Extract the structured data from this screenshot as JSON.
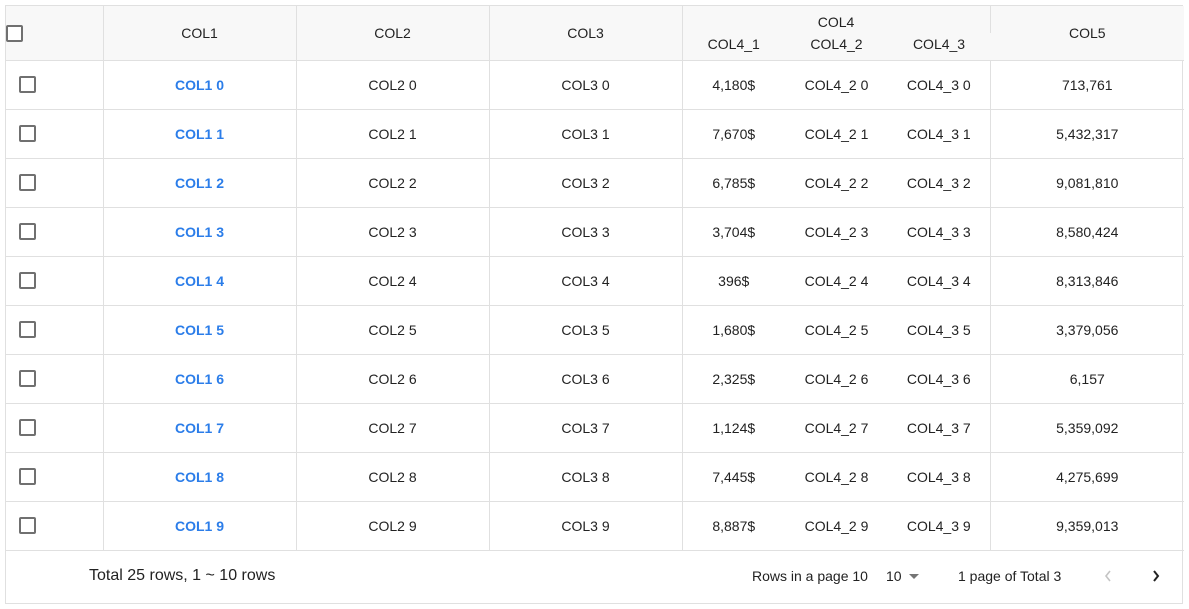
{
  "header": {
    "select_all_label": "",
    "col1": "COL1",
    "col2": "COL2",
    "col3": "COL3",
    "col4": "COL4",
    "col4_1": "COL4_1",
    "col4_2": "COL4_2",
    "col4_3": "COL4_3",
    "col5": "COL5"
  },
  "rows": [
    {
      "checked": false,
      "col1": "COL1 0",
      "col2": "COL2 0",
      "col3": "COL3 0",
      "col4_1": "4,180$",
      "col4_2": "COL4_2 0",
      "col4_3": "COL4_3 0",
      "col5": "713,761"
    },
    {
      "checked": false,
      "col1": "COL1 1",
      "col2": "COL2 1",
      "col3": "COL3 1",
      "col4_1": "7,670$",
      "col4_2": "COL4_2 1",
      "col4_3": "COL4_3 1",
      "col5": "5,432,317"
    },
    {
      "checked": false,
      "col1": "COL1 2",
      "col2": "COL2 2",
      "col3": "COL3 2",
      "col4_1": "6,785$",
      "col4_2": "COL4_2 2",
      "col4_3": "COL4_3 2",
      "col5": "9,081,810"
    },
    {
      "checked": false,
      "col1": "COL1 3",
      "col2": "COL2 3",
      "col3": "COL3 3",
      "col4_1": "3,704$",
      "col4_2": "COL4_2 3",
      "col4_3": "COL4_3 3",
      "col5": "8,580,424"
    },
    {
      "checked": false,
      "col1": "COL1 4",
      "col2": "COL2 4",
      "col3": "COL3 4",
      "col4_1": "396$",
      "col4_2": "COL4_2 4",
      "col4_3": "COL4_3 4",
      "col5": "8,313,846"
    },
    {
      "checked": false,
      "col1": "COL1 5",
      "col2": "COL2 5",
      "col3": "COL3 5",
      "col4_1": "1,680$",
      "col4_2": "COL4_2 5",
      "col4_3": "COL4_3 5",
      "col5": "3,379,056"
    },
    {
      "checked": false,
      "col1": "COL1 6",
      "col2": "COL2 6",
      "col3": "COL3 6",
      "col4_1": "2,325$",
      "col4_2": "COL4_2 6",
      "col4_3": "COL4_3 6",
      "col5": "6,157"
    },
    {
      "checked": false,
      "col1": "COL1 7",
      "col2": "COL2 7",
      "col3": "COL3 7",
      "col4_1": "1,124$",
      "col4_2": "COL4_2 7",
      "col4_3": "COL4_3 7",
      "col5": "5,359,092"
    },
    {
      "checked": false,
      "col1": "COL1 8",
      "col2": "COL2 8",
      "col3": "COL3 8",
      "col4_1": "7,445$",
      "col4_2": "COL4_2 8",
      "col4_3": "COL4_3 8",
      "col5": "4,275,699"
    },
    {
      "checked": false,
      "col1": "COL1 9",
      "col2": "COL2 9",
      "col3": "COL3 9",
      "col4_1": "8,887$",
      "col4_2": "COL4_2 9",
      "col4_3": "COL4_3 9",
      "col5": "9,359,013"
    }
  ],
  "footer": {
    "total_text": "Total 25 rows, 1 ~ 10 rows",
    "rows_per_page_label": "Rows in a page 10",
    "rows_per_page_value": "10",
    "page_info": "1 page of Total 3",
    "prev_icon": "chevron-left-icon",
    "next_icon": "chevron-right-icon",
    "prev_enabled": false,
    "next_enabled": true
  },
  "colors": {
    "link": "#2b7de9",
    "header_bg": "#f8f8f8",
    "border": "#e0e0e0",
    "disabled_icon": "#c4c4c4",
    "enabled_icon": "#222222"
  }
}
